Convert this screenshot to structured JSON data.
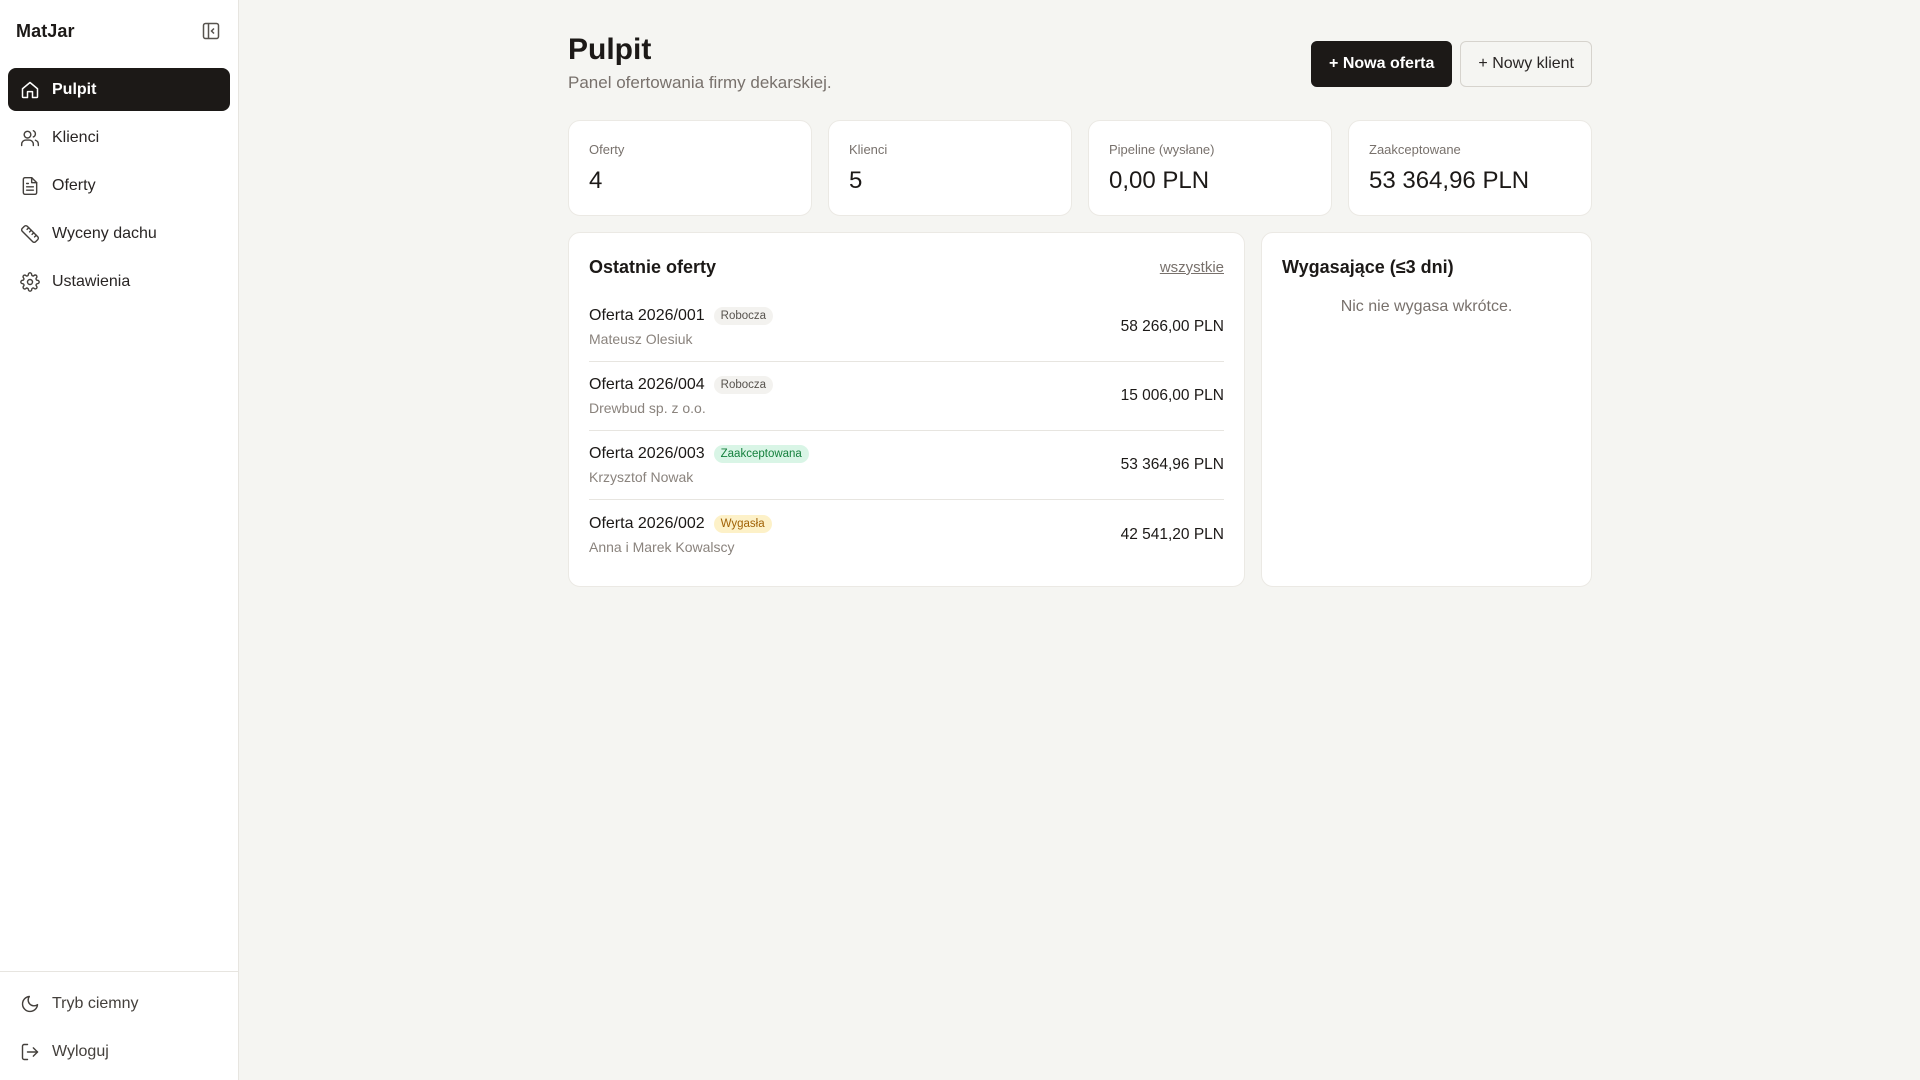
{
  "app": {
    "brand": "MatJar"
  },
  "sidebar": {
    "items": [
      {
        "label": "Pulpit",
        "icon": "home-icon",
        "active": true
      },
      {
        "label": "Klienci",
        "icon": "users-icon"
      },
      {
        "label": "Oferty",
        "icon": "file-text-icon"
      },
      {
        "label": "Wyceny dachu",
        "icon": "ruler-icon"
      },
      {
        "label": "Ustawienia",
        "icon": "gear-icon"
      }
    ],
    "bottom": [
      {
        "label": "Tryb ciemny",
        "icon": "moon-icon"
      },
      {
        "label": "Wyloguj",
        "icon": "logout-icon"
      }
    ]
  },
  "header": {
    "title": "Pulpit",
    "subtitle": "Panel ofertowania firmy dekarskiej.",
    "new_offer_label": "+ Nowa oferta",
    "new_client_label": "+ Nowy klient"
  },
  "stats": [
    {
      "label": "Oferty",
      "value": "4"
    },
    {
      "label": "Klienci",
      "value": "5"
    },
    {
      "label": "Pipeline (wysłane)",
      "value": "0,00 PLN"
    },
    {
      "label": "Zaakceptowane",
      "value": "53 364,96 PLN"
    }
  ],
  "recent": {
    "title": "Ostatnie oferty",
    "link_label": "wszystkie",
    "offers": [
      {
        "name": "Oferta 2026/001",
        "status": "Robocza",
        "client": "Mateusz Olesiuk",
        "amount": "58 266,00 PLN"
      },
      {
        "name": "Oferta 2026/004",
        "status": "Robocza",
        "client": "Drewbud sp. z o.o.",
        "amount": "15 006,00 PLN"
      },
      {
        "name": "Oferta 2026/003",
        "status": "Zaakceptowana",
        "client": "Krzysztof Nowak",
        "amount": "53 364,96 PLN"
      },
      {
        "name": "Oferta 2026/002",
        "status": "Wygasła",
        "client": "Anna i Marek Kowalscy",
        "amount": "42 541,20 PLN"
      }
    ]
  },
  "expiring": {
    "title": "Wygasające (≤3 dni)",
    "empty_message": "Nic nie wygasa wkrótce."
  },
  "colors": {
    "accent": "#1c1917",
    "background": "#f5f5f2",
    "accepted": "#15803d",
    "expired": "#a16207"
  }
}
